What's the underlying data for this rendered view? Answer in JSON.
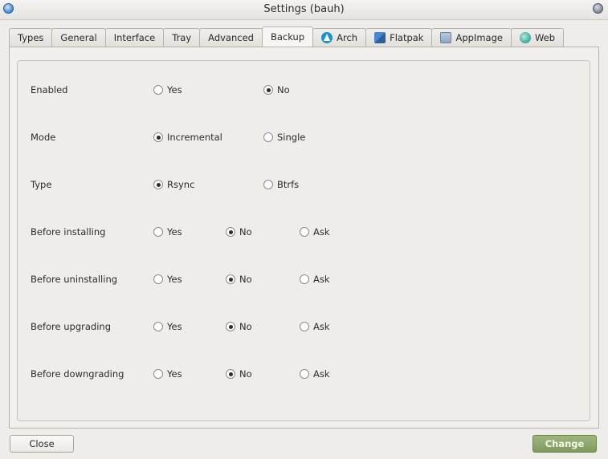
{
  "window": {
    "title": "Settings (bauh)"
  },
  "tabs": [
    {
      "label": "Types",
      "icon": "",
      "active": false
    },
    {
      "label": "General",
      "icon": "",
      "active": false
    },
    {
      "label": "Interface",
      "icon": "",
      "active": false
    },
    {
      "label": "Tray",
      "icon": "",
      "active": false
    },
    {
      "label": "Advanced",
      "icon": "",
      "active": false
    },
    {
      "label": "Backup",
      "icon": "",
      "active": true
    },
    {
      "label": "Arch",
      "icon": "arch-icon",
      "active": false
    },
    {
      "label": "Flatpak",
      "icon": "flatpak-icon",
      "active": false
    },
    {
      "label": "AppImage",
      "icon": "appimage-icon",
      "active": false
    },
    {
      "label": "Web",
      "icon": "web-icon",
      "active": false
    }
  ],
  "backup": {
    "rows": [
      {
        "label": "Enabled",
        "options": [
          {
            "label": "Yes",
            "checked": false
          },
          {
            "label": "No",
            "checked": true
          }
        ]
      },
      {
        "label": "Mode",
        "options": [
          {
            "label": "Incremental",
            "checked": true
          },
          {
            "label": "Single",
            "checked": false
          }
        ]
      },
      {
        "label": "Type",
        "options": [
          {
            "label": "Rsync",
            "checked": true
          },
          {
            "label": "Btrfs",
            "checked": false
          }
        ]
      },
      {
        "label": "Before installing",
        "options": [
          {
            "label": "Yes",
            "checked": false
          },
          {
            "label": "No",
            "checked": true
          },
          {
            "label": "Ask",
            "checked": false
          }
        ]
      },
      {
        "label": "Before uninstalling",
        "options": [
          {
            "label": "Yes",
            "checked": false
          },
          {
            "label": "No",
            "checked": true
          },
          {
            "label": "Ask",
            "checked": false
          }
        ]
      },
      {
        "label": "Before upgrading",
        "options": [
          {
            "label": "Yes",
            "checked": false
          },
          {
            "label": "No",
            "checked": true
          },
          {
            "label": "Ask",
            "checked": false
          }
        ]
      },
      {
        "label": "Before downgrading",
        "options": [
          {
            "label": "Yes",
            "checked": false
          },
          {
            "label": "No",
            "checked": true
          },
          {
            "label": "Ask",
            "checked": false
          }
        ]
      }
    ]
  },
  "footer": {
    "close_label": "Close",
    "change_label": "Change"
  },
  "colors": {
    "accent": "#8aa56a",
    "background": "#efede9"
  }
}
